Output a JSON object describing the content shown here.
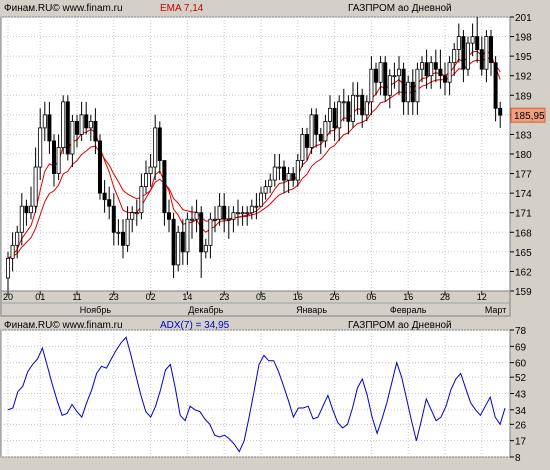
{
  "chart_data": [
    {
      "type": "candlestick",
      "header": {
        "source": "Финам.RU©  www.finam.ru",
        "indicator": "EMA 7,14",
        "instrument": "ГАЗПРОМ ао Дневной"
      },
      "y_ticks": [
        159,
        162,
        165,
        168,
        171,
        174,
        177,
        180,
        183,
        186,
        189,
        192,
        195,
        198,
        201
      ],
      "ylim": [
        159,
        201
      ],
      "x_tick_labels": [
        "20",
        "01",
        "11",
        "23",
        "02",
        "14",
        "23",
        "05",
        "16",
        "26",
        "06",
        "16",
        "28",
        "12"
      ],
      "x_tick_index": [
        0,
        7,
        15,
        23,
        31,
        39,
        47,
        55,
        63,
        71,
        79,
        87,
        95,
        103
      ],
      "month_labels": [
        "Ноябрь",
        "Декабрь",
        "Январь",
        "Февраль",
        "Март"
      ],
      "month_label_index": [
        19,
        43,
        66,
        87,
        106
      ],
      "last_price_label": "185,95",
      "last_price": 185.95,
      "candles": {
        "open": [
          161,
          164,
          166,
          168,
          172,
          171,
          172,
          178,
          184,
          186,
          182,
          177,
          181,
          188,
          180,
          185,
          183,
          186,
          184,
          185,
          182,
          174,
          173,
          172,
          168,
          168,
          166,
          170,
          171,
          171,
          175,
          177,
          178,
          184,
          179,
          171,
          170,
          163,
          168,
          165,
          170,
          170,
          171,
          165,
          166,
          170,
          170,
          172,
          170,
          170,
          171,
          171,
          171,
          171,
          172,
          172,
          174,
          175,
          176,
          178,
          178,
          176,
          177,
          176,
          179,
          183,
          181,
          186,
          183,
          182,
          185,
          187,
          184,
          188,
          188,
          185,
          189,
          189,
          186,
          188,
          193,
          191,
          194,
          189,
          192,
          192,
          193,
          188,
          191,
          188,
          193,
          194,
          192,
          194,
          193,
          192,
          191,
          194,
          196,
          198,
          193,
          197,
          198,
          196,
          193,
          198,
          194,
          187
        ],
        "close": [
          164,
          166,
          168,
          172,
          171,
          172,
          178,
          184,
          186,
          182,
          177,
          181,
          188,
          180,
          185,
          183,
          186,
          184,
          185,
          182,
          174,
          173,
          172,
          168,
          168,
          166,
          170,
          171,
          171,
          175,
          177,
          178,
          184,
          179,
          171,
          170,
          163,
          168,
          165,
          170,
          170,
          171,
          165,
          166,
          170,
          170,
          172,
          170,
          170,
          171,
          171,
          171,
          171,
          172,
          172,
          174,
          175,
          176,
          178,
          178,
          176,
          177,
          176,
          179,
          183,
          181,
          186,
          183,
          182,
          185,
          187,
          184,
          188,
          188,
          185,
          189,
          189,
          186,
          188,
          193,
          191,
          194,
          189,
          192,
          192,
          193,
          188,
          191,
          188,
          193,
          194,
          192,
          194,
          193,
          192,
          191,
          194,
          196,
          198,
          193,
          197,
          198,
          196,
          193,
          198,
          194,
          187,
          185.95
        ],
        "high": [
          165,
          168,
          169,
          174,
          173,
          175,
          181,
          187,
          188,
          188,
          183,
          183,
          189,
          189,
          186,
          186,
          188,
          188,
          186,
          187,
          183,
          176,
          175,
          174,
          170,
          170,
          172,
          172,
          173,
          177,
          179,
          180,
          186,
          185,
          179,
          173,
          171,
          169,
          170,
          171,
          172,
          173,
          172,
          167,
          171,
          172,
          174,
          174,
          172,
          172,
          173,
          172,
          172,
          173,
          174,
          175,
          176,
          177,
          180,
          180,
          179,
          178,
          178,
          180,
          184,
          184,
          187,
          187,
          184,
          186,
          189,
          188,
          189,
          190,
          189,
          191,
          191,
          190,
          189,
          195,
          194,
          195,
          195,
          193,
          194,
          195,
          194,
          192,
          193,
          194,
          195,
          196,
          195,
          196,
          196,
          194,
          195,
          197,
          200,
          199,
          198,
          200,
          201,
          198,
          199,
          199,
          195,
          188
        ],
        "low": [
          159,
          162,
          164,
          166,
          169,
          170,
          171,
          176,
          182,
          180,
          175,
          176,
          180,
          179,
          178,
          181,
          182,
          183,
          182,
          180,
          173,
          171,
          170,
          166,
          166,
          164,
          165,
          168,
          169,
          170,
          174,
          175,
          176,
          177,
          169,
          168,
          161,
          162,
          163,
          163,
          167,
          168,
          161,
          164,
          164,
          168,
          169,
          168,
          167,
          168,
          169,
          169,
          169,
          170,
          170,
          172,
          173,
          174,
          175,
          176,
          174,
          174,
          175,
          175,
          178,
          179,
          180,
          181,
          180,
          181,
          183,
          182,
          182,
          185,
          183,
          184,
          186,
          184,
          185,
          186,
          189,
          189,
          188,
          187,
          190,
          189,
          186,
          186,
          186,
          186,
          191,
          190,
          190,
          191,
          190,
          189,
          189,
          192,
          194,
          191,
          192,
          195,
          194,
          192,
          191,
          192,
          185,
          184
        ]
      },
      "ema_fast": {
        "name": "EMA 7",
        "color": "#dd0000"
      },
      "ema_slow": {
        "name": "EMA 14",
        "color": "#dd0000"
      }
    },
    {
      "type": "line",
      "header": {
        "source": "Финам.RU©  www.finam.ru",
        "indicator": "ADX(7) = 34,95",
        "instrument": "ГАЗПРОМ ао Дневной"
      },
      "y_ticks": [
        8,
        17,
        26,
        34,
        43,
        52,
        60,
        69,
        78
      ],
      "ylim": [
        8,
        78
      ],
      "series": [
        {
          "name": "ADX(7)",
          "color": "#0000cc",
          "values": [
            34,
            35,
            44,
            47,
            55,
            59,
            62,
            68,
            58,
            48,
            39,
            31,
            32,
            37,
            33,
            30,
            38,
            45,
            54,
            58,
            57,
            62,
            67,
            71,
            74,
            64,
            53,
            42,
            33,
            30,
            36,
            45,
            56,
            59,
            46,
            31,
            28,
            36,
            34,
            33,
            29,
            26,
            20,
            19,
            20,
            18,
            15,
            11,
            17,
            30,
            44,
            59,
            64,
            61,
            61,
            55,
            47,
            39,
            30,
            35,
            35,
            36,
            29,
            30,
            36,
            42,
            34,
            27,
            24,
            26,
            35,
            46,
            51,
            42,
            30,
            21,
            29,
            38,
            49,
            60,
            52,
            40,
            28,
            17,
            28,
            40,
            34,
            28,
            30,
            36,
            45,
            51,
            54,
            46,
            38,
            34,
            31,
            36,
            41,
            30,
            26,
            34.95
          ]
        }
      ],
      "last_value_label": "34,95"
    }
  ]
}
